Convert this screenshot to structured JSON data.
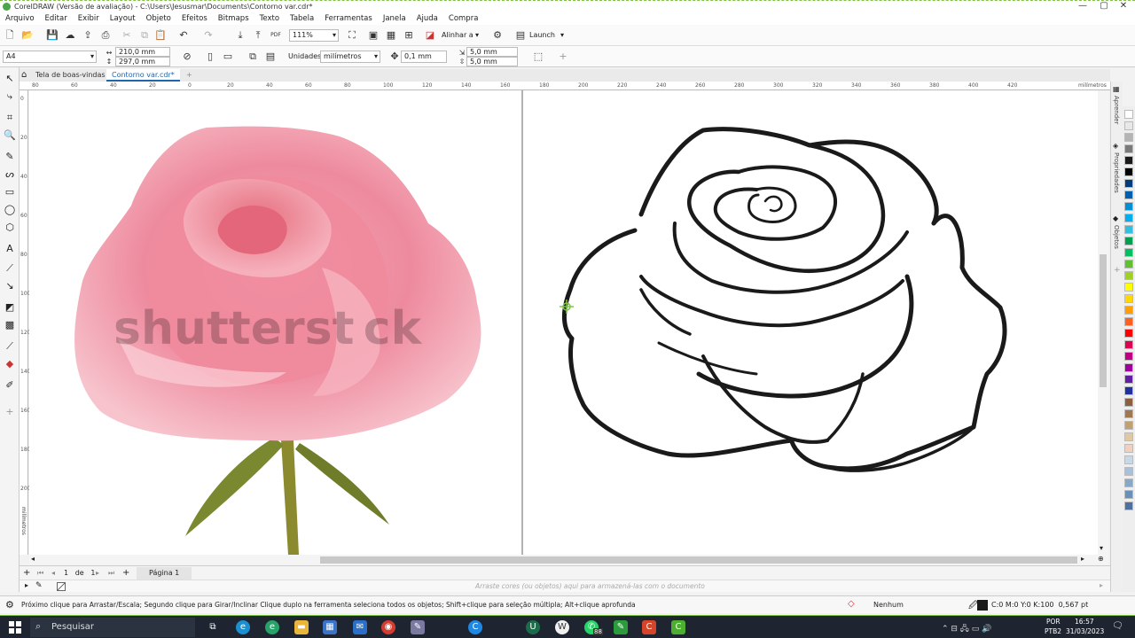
{
  "window": {
    "title": "CorelDRAW (Versão de avaliação) - C:\\Users\\Jesusmar\\Documents\\Contorno var.cdr*"
  },
  "menu": [
    "Arquivo",
    "Editar",
    "Exibir",
    "Layout",
    "Objeto",
    "Efeitos",
    "Bitmaps",
    "Texto",
    "Tabela",
    "Ferramentas",
    "Janela",
    "Ajuda",
    "Compra"
  ],
  "toolbar": {
    "zoom": "111%",
    "align_label": "Alinhar a",
    "launch_label": "Launch"
  },
  "propbar": {
    "page_size": "A4",
    "width": "210,0 mm",
    "height": "297,0 mm",
    "units_label": "Unidades:",
    "units_value": "milímetros",
    "nudge": "0,1 mm",
    "dup_x": "5,0 mm",
    "dup_y": "5,0 mm"
  },
  "tabs": [
    {
      "label": "Tela de boas-vindas"
    },
    {
      "label": "Contorno var.cdr*"
    }
  ],
  "ruler": {
    "h_ticks": [
      "80",
      "60",
      "40",
      "20",
      "0",
      "20",
      "40",
      "60",
      "80",
      "100",
      "120",
      "140",
      "160",
      "180",
      "200",
      "220",
      "240",
      "260",
      "280",
      "300",
      "320",
      "340",
      "360",
      "380",
      "400",
      "420"
    ],
    "h_unit": "milímetros",
    "v_ticks": [
      "0",
      "20",
      "40",
      "60",
      "80",
      "100",
      "120",
      "140",
      "160",
      "180",
      "200"
    ],
    "v_unit": "milímetros"
  },
  "canvas": {
    "watermark": "shutterst ck"
  },
  "pagebar": {
    "page_info": "1   de   1",
    "page_tab": "Página 1"
  },
  "colorbar": {
    "hint": "Arraste cores (ou objetos) aqui para armazená-las com o documento"
  },
  "dock": {
    "tabs": [
      "Aprender",
      "Propriedades",
      "Objetos"
    ]
  },
  "palette": [
    "#ffffff",
    "#e8e8e8",
    "#b4b4b4",
    "#7a7a7a",
    "#1a1a1a",
    "#000000",
    "#003d7a",
    "#0060b0",
    "#0090d8",
    "#00b0f0",
    "#30c0e0",
    "#00a050",
    "#00c060",
    "#60c030",
    "#a0d020",
    "#ffff00",
    "#ffd800",
    "#ffa000",
    "#ff6020",
    "#ff0000",
    "#e00050",
    "#c00080",
    "#a000a0",
    "#6020a0",
    "#2030a0",
    "#8a6040",
    "#a07850",
    "#c0a070",
    "#e0c8a0",
    "#f0d0c0",
    "#c8d8e8",
    "#a8c0d8",
    "#88a8c8",
    "#6890b8",
    "#5070a0"
  ],
  "status": {
    "hint": "Próximo clique para Arrastar/Escala; Segundo clique para Girar/Inclinar Clique duplo na ferramenta seleciona todos os objetos; Shift+clique para seleção múltipla; Alt+clique aprofunda",
    "fill": "Nenhum",
    "outline": "C:0 M:0 Y:0 K:100  0,567 pt"
  },
  "taskbar": {
    "search": "Pesquisar",
    "lang": "POR",
    "kbd": "PTB2",
    "time": "16:57",
    "date": "31/03/2023",
    "badge": "88"
  }
}
